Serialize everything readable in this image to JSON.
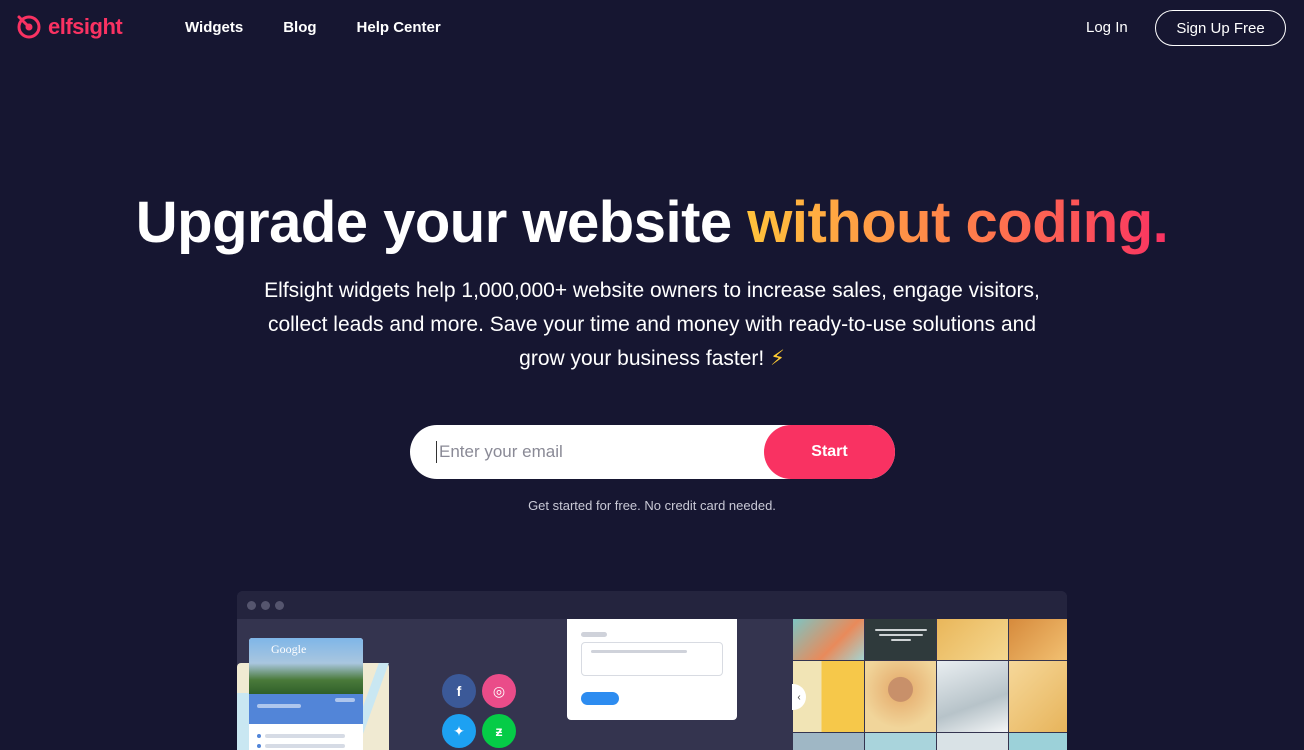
{
  "brand": {
    "name": "elfsight",
    "color": "#f93262"
  },
  "nav": {
    "links": [
      "Widgets",
      "Blog",
      "Help Center"
    ],
    "login": "Log In",
    "signup": "Sign Up Free"
  },
  "hero": {
    "headline_plain": "Upgrade your website ",
    "headline_accent": "without coding.",
    "subtext": "Elfsight widgets help 1,000,000+ website owners to increase sales, engage visitors, collect leads and more. Save your time and money with ready-to-use solutions and grow your business faster!",
    "bolt_icon": "⚡",
    "email_placeholder": "Enter your email",
    "start_label": "Start",
    "note": "Get started for free. No credit card needed."
  },
  "mock": {
    "google_label": "Google",
    "social_icons": [
      "facebook-icon",
      "dribbble-icon",
      "twitter-icon",
      "deviantart-icon"
    ],
    "gallery_prev_icon": "‹"
  },
  "colors": {
    "background": "#161631",
    "accent_start": "#ffc23c",
    "accent_end": "#f93262",
    "button": "#f93262"
  }
}
